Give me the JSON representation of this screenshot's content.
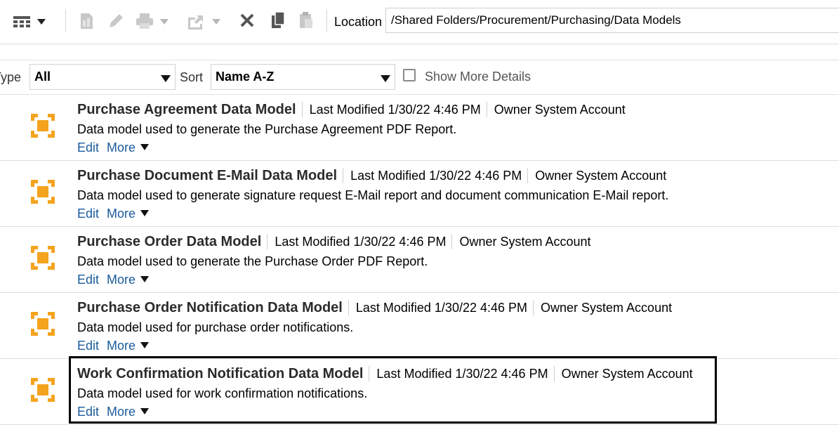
{
  "toolbar": {
    "icons": [
      "view-grid-icon",
      "report-icon",
      "edit-icon",
      "print-icon",
      "share-icon",
      "delete-icon",
      "copy-icon",
      "paste-icon"
    ],
    "location_label": "Location",
    "location_value": "/Shared Folders/Procurement/Purchasing/Data Models"
  },
  "filters": {
    "type_label": "Type",
    "type_value": "All",
    "sort_label": "Sort",
    "sort_value": "Name A-Z",
    "show_more_label": "Show More Details",
    "show_more_checked": false
  },
  "items": [
    {
      "title": "Purchase Agreement Data Model",
      "last_modified": "Last Modified 1/30/22 4:46 PM",
      "owner": "Owner System Account",
      "description": "Data model used to generate the Purchase Agreement PDF Report.",
      "edit": "Edit",
      "more": "More"
    },
    {
      "title": "Purchase Document E-Mail Data Model",
      "last_modified": "Last Modified 1/30/22 4:46 PM",
      "owner": "Owner System Account",
      "description": "Data model used to generate signature request E-Mail report and document communication E-Mail report.",
      "edit": "Edit",
      "more": "More"
    },
    {
      "title": "Purchase Order Data Model",
      "last_modified": "Last Modified 1/30/22 4:46 PM",
      "owner": "Owner System Account",
      "description": "Data model used to generate the Purchase Order PDF Report.",
      "edit": "Edit",
      "more": "More"
    },
    {
      "title": "Purchase Order Notification Data Model",
      "last_modified": "Last Modified 1/30/22 4:46 PM",
      "owner": "Owner System Account",
      "description": "Data model used for purchase order notifications.",
      "edit": "Edit",
      "more": "More"
    },
    {
      "title": "Work Confirmation Notification Data Model",
      "last_modified": "Last Modified 1/30/22 4:46 PM",
      "owner": "Owner System Account",
      "description": "Data model used for work confirmation notifications.",
      "edit": "Edit",
      "more": "More"
    }
  ],
  "colors": {
    "accent_link": "#1a5b9c",
    "data_model_icon": "#f4a31e"
  }
}
